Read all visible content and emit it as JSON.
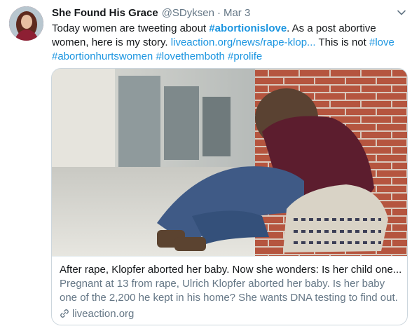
{
  "tweet": {
    "author_name": "She Found His Grace",
    "author_handle": "@SDyksen",
    "separator": "·",
    "time": "Mar 3",
    "text": {
      "part1": "Today women are tweeting about ",
      "hashtag1": "#abortionislove",
      "part2": ". As a post abortive",
      "part3": "women, here is my story. ",
      "link": "liveaction.org/news/rape-klop...",
      "part4": " This is not ",
      "hashtag2": "#love",
      "hashtag3": "#abortionhurtswomen",
      "hashtag4": "#lovethemboth",
      "hashtag5": "#prolife"
    }
  },
  "card": {
    "title": "After rape, Klopfer aborted her baby. Now she wonders: Is her child one...",
    "description_line1": "Pregnant at 13 from rape, Ulrich Klopfer aborted her baby. Is her baby",
    "description_line2": "one of the 2,200 he kept in his home? She wants DNA testing to find out.",
    "domain": "liveaction.org"
  },
  "icons": {
    "caret": "chevron-down-icon",
    "link": "link-icon",
    "avatar": "avatar"
  },
  "colors": {
    "link_blue": "#1b95e0",
    "secondary_text": "#657786",
    "primary_text": "#14171a",
    "border": "#ccd6dd"
  }
}
